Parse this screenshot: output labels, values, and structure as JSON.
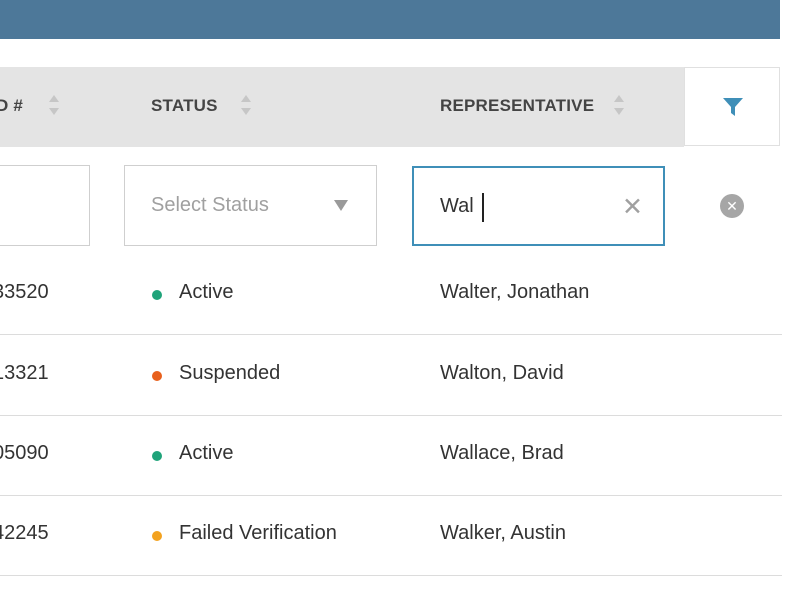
{
  "header": {
    "columns": [
      {
        "label": "D #"
      },
      {
        "label": "STATUS"
      },
      {
        "label": "REPRESENTATIVE"
      }
    ],
    "filter_icon": "filter-icon",
    "accent_color": "#3f8fb8"
  },
  "filters": {
    "status_placeholder": "Select Status",
    "representative_value": "Wal",
    "clear_icon": "clear-x-icon",
    "clear_all_icon": "clear-circle-x-icon"
  },
  "rows": [
    {
      "id": "33520",
      "status": "Active",
      "status_color": "#1fa37a",
      "representative": "Walter, Jonathan"
    },
    {
      "id": "13321",
      "status": "Suspended",
      "status_color": "#e8601c",
      "representative": "Walton, David"
    },
    {
      "id": "05090",
      "status": "Active",
      "status_color": "#1fa37a",
      "representative": "Wallace, Brad"
    },
    {
      "id": "42245",
      "status": "Failed Verification",
      "status_color": "#f3a21f",
      "representative": "Walker, Austin"
    }
  ]
}
